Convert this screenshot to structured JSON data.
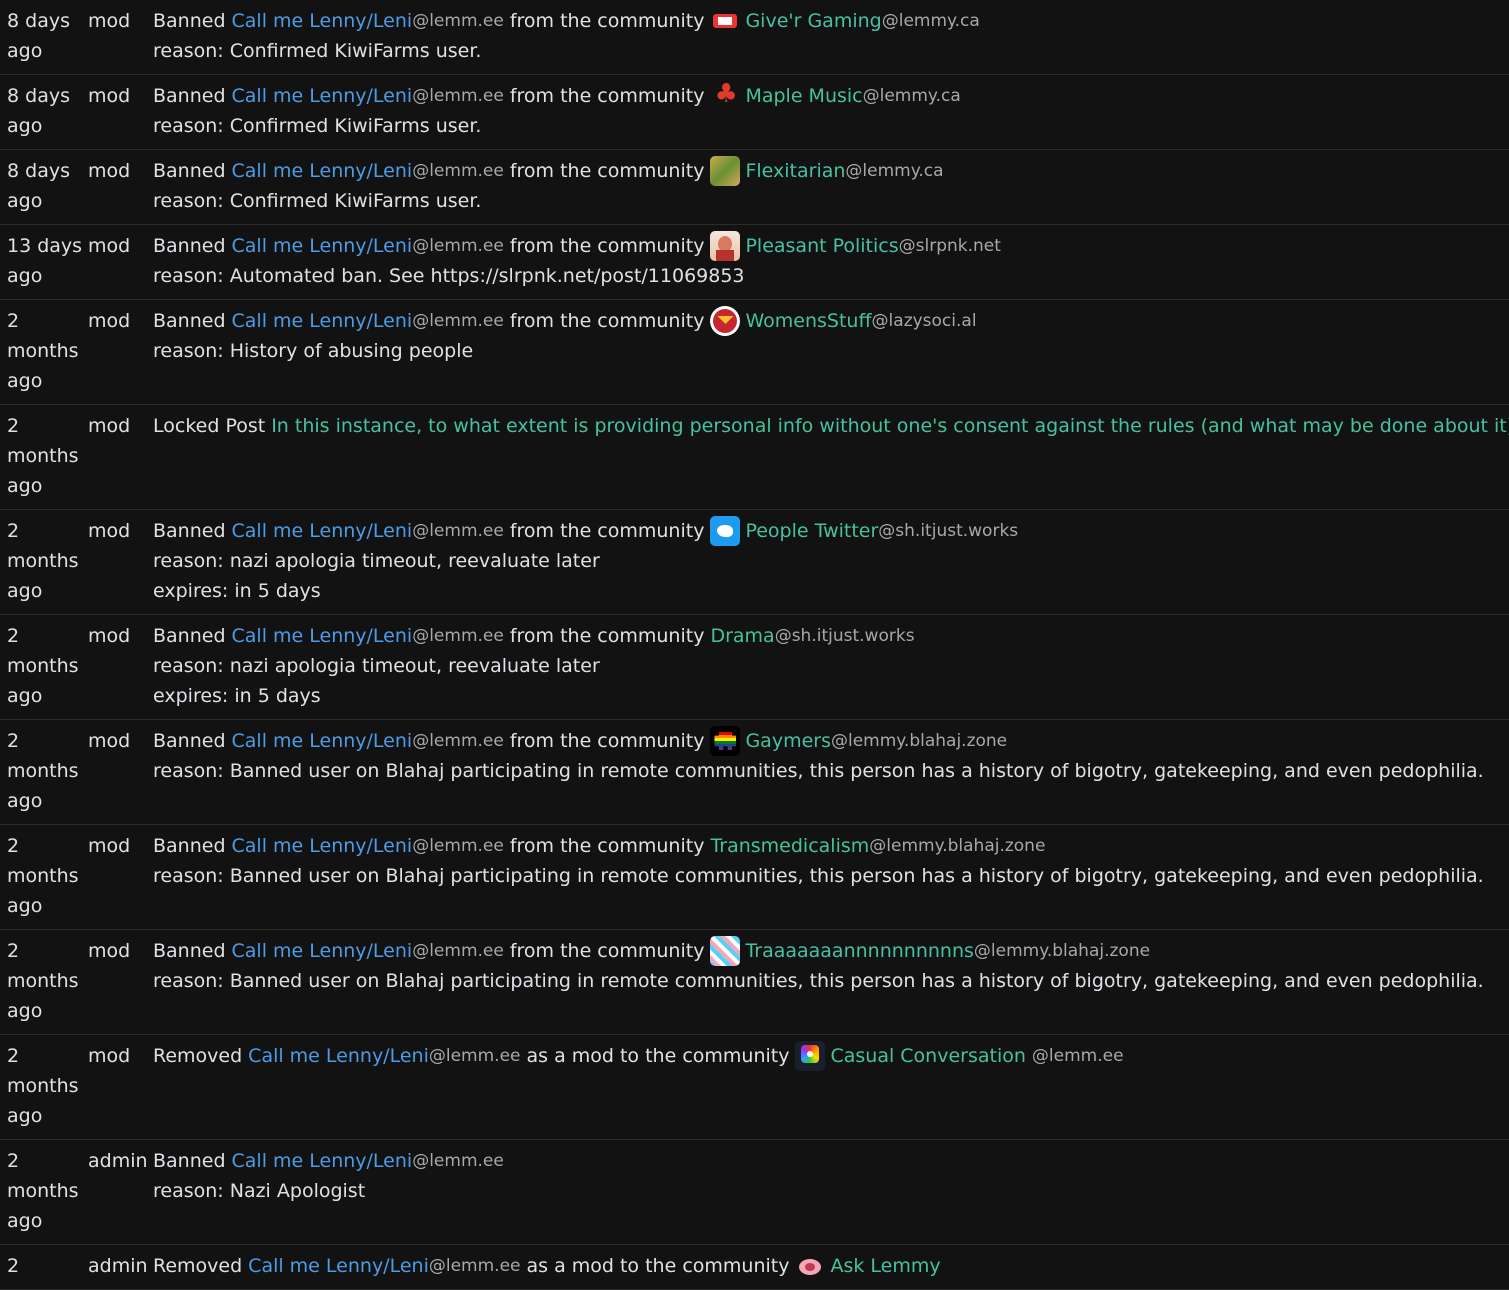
{
  "labels": {
    "banned": "Banned",
    "from_community": "from the community",
    "removed": "Removed",
    "as_mod": "as a mod to the community",
    "locked_post": "Locked Post"
  },
  "user": {
    "name": "Call me Lenny/Leni",
    "instance": "@lemm.ee"
  },
  "rows": [
    {
      "time": [
        "8 days",
        "ago"
      ],
      "role": "mod",
      "community": "Give'r Gaming",
      "community_instance": "@lemmy.ca",
      "icon": "giver-gaming-icon",
      "reason": "reason: Confirmed KiwiFarms user."
    },
    {
      "time": [
        "8 days",
        "ago"
      ],
      "role": "mod",
      "community": "Maple Music",
      "community_instance": "@lemmy.ca",
      "icon": "maple-leaf-icon",
      "reason": "reason: Confirmed KiwiFarms user."
    },
    {
      "time": [
        "8 days",
        "ago"
      ],
      "role": "mod",
      "community": "Flexitarian",
      "community_instance": "@lemmy.ca",
      "icon": "flexitarian-icon",
      "reason": "reason: Confirmed KiwiFarms user."
    },
    {
      "time": [
        "13 days",
        "ago"
      ],
      "role": "mod",
      "community": "Pleasant Politics",
      "community_instance": "@slrpnk.net",
      "icon": "pleasant-politics-icon",
      "reason": "reason: Automated ban. See https://slrpnk.net/post/11069853"
    },
    {
      "time": [
        "2",
        "months",
        "ago"
      ],
      "role": "mod",
      "community": "WomensStuff",
      "community_instance": "@lazysoci.al",
      "icon": "wonder-woman-icon",
      "reason": "reason: History of abusing people"
    },
    {
      "time": [
        "2",
        "months",
        "ago"
      ],
      "role": "mod",
      "post_title": "In this instance, to what extent is providing personal info without one's consent against the rules (and what may be done about it)?"
    },
    {
      "time": [
        "2",
        "months",
        "ago"
      ],
      "role": "mod",
      "community": "People Twitter",
      "community_instance": "@sh.itjust.works",
      "icon": "twitter-bird-icon",
      "reason": "reason: nazi apologia timeout, reevaluate later",
      "expires": "expires: in 5 days"
    },
    {
      "time": [
        "2",
        "months",
        "ago"
      ],
      "role": "mod",
      "community": "Drama",
      "community_instance": "@sh.itjust.works",
      "reason": "reason: nazi apologia timeout, reevaluate later",
      "expires": "expires: in 5 days"
    },
    {
      "time": [
        "2",
        "months",
        "ago"
      ],
      "role": "mod",
      "community": "Gaymers",
      "community_instance": "@lemmy.blahaj.zone",
      "icon": "rainbow-invader-icon",
      "reason": "reason: Banned user on Blahaj participating in remote communities, this person has a history of bigotry, gatekeeping, and even pedophilia."
    },
    {
      "time": [
        "2",
        "months",
        "ago"
      ],
      "role": "mod",
      "community": "Transmedicalism",
      "community_instance": "@lemmy.blahaj.zone",
      "reason": "reason: Banned user on Blahaj participating in remote communities, this person has a history of bigotry, gatekeeping, and even pedophilia."
    },
    {
      "time": [
        "2",
        "months",
        "ago"
      ],
      "role": "mod",
      "community": "Traaaaaaannnnnnnnnns",
      "community_instance": "@lemmy.blahaj.zone",
      "icon": "trans-pattern-icon",
      "reason": "reason: Banned user on Blahaj participating in remote communities, this person has a history of bigotry, gatekeeping, and even pedophilia."
    },
    {
      "time": [
        "2",
        "months",
        "ago"
      ],
      "role": "mod",
      "community": "Casual Conversation",
      "community_instance": "@lemm.ee",
      "icon": "casual-conversation-icon"
    },
    {
      "time": [
        "2",
        "months",
        "ago"
      ],
      "role": "admin",
      "reason": "reason: Nazi Apologist"
    },
    {
      "time": [
        "2"
      ],
      "role": "admin",
      "community": "Ask Lemmy",
      "icon": "ask-lemmy-icon"
    }
  ]
}
